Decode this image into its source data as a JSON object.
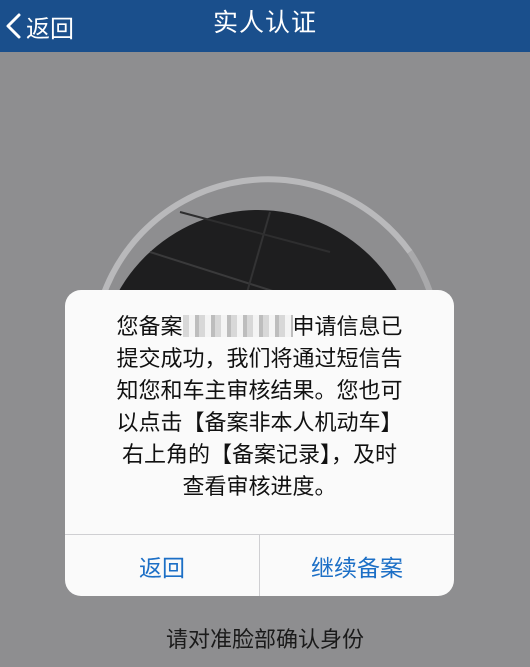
{
  "nav": {
    "back_label": "返回",
    "title": "实人认证"
  },
  "dialog": {
    "message": "您备案▒▒▒▒申请信息已提交成功，我们将通过短信告知您和车主审核结果。您也可以点击【备案非本人机动车】右上角的【备案记录】，及时查看审核进度。",
    "line1": "您备案",
    "masked": "▒▒▒▒",
    "line1_tail": "申请信息已",
    "line2": "提交成功，我们将通过短信告",
    "line3": "知您和车主审核结果。您也可",
    "line4": "以点击【备案非本人机动车】",
    "line5": "右上角的【备案记录】，及时",
    "line6": "查看审核进度。",
    "buttons": {
      "back": "返回",
      "continue": "继续备案"
    }
  },
  "hint": "请对准脸部确认身份",
  "colors": {
    "navbar": "#1a4f8c",
    "overlay": "#8e8e90",
    "button_text": "#1c6fc6"
  }
}
